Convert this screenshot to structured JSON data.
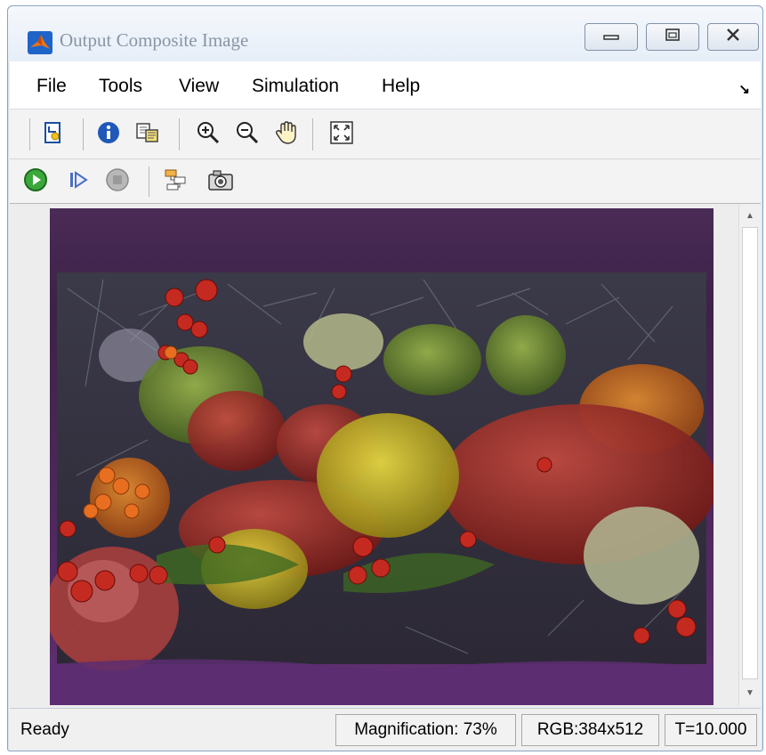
{
  "window": {
    "title": "Output Composite Image",
    "icon": "matlab-logo-icon"
  },
  "window_controls": {
    "minimize_icon": "minimize-icon",
    "maximize_icon": "maximize-icon",
    "close_icon": "close-icon"
  },
  "menu": {
    "items": [
      "File",
      "Tools",
      "View",
      "Simulation",
      "Help"
    ],
    "corner_icon": "undock-arrow-icon"
  },
  "toolbar1": {
    "tools": [
      "print-icon",
      "info-icon",
      "copy-to-clipboard-icon",
      "zoom-in-icon",
      "zoom-out-icon",
      "pan-hand-icon",
      "fit-to-view-icon"
    ]
  },
  "toolbar2": {
    "tools": [
      "run-icon",
      "step-forward-icon",
      "stop-icon",
      "highlight-block-icon",
      "snapshot-icon"
    ],
    "colors": {
      "run": "#2a9d2a",
      "stop": "#9a9a9a"
    }
  },
  "image": {
    "description_icon": "composite-image-peppers-over-pine-branches"
  },
  "status": {
    "ready": "Ready",
    "magnification": "Magnification: 73%",
    "dimensions": "RGB:384x512",
    "time": "T=10.000"
  }
}
